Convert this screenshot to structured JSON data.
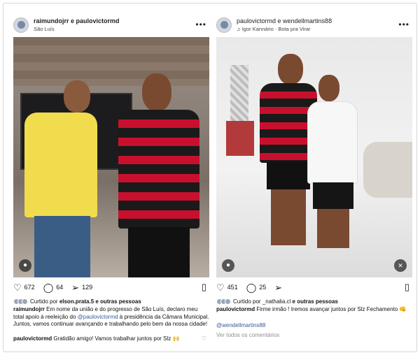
{
  "left_post": {
    "header": {
      "users": "raimundojrr e paulovictormd",
      "location": "São Luís"
    },
    "actions": {
      "likes": "672",
      "comments": "64",
      "shares": "129"
    },
    "liked_by": {
      "prefix": "Curtido por",
      "user": "elson.prata.5",
      "suffix": "e outras pessoas"
    },
    "caption": {
      "user": "raimundojrr",
      "text_before": "Em nome da união e do progresso de São Luís, declaro meu total apoio à reeleição do",
      "mention": "@paulovictormd",
      "text_after": "à presidência da Câmara Municipal. Juntos, vamos continuar avançando e trabalhando pelo bem da nossa cidade!"
    },
    "comment": {
      "user": "paulovictormd",
      "text": "Gratidão amigo! Vamos trabalhar juntos por Slz 🙌"
    }
  },
  "right_post": {
    "header": {
      "users": "paulovictormd e wendellmartins88",
      "audio": "Igor Kannário · Bota pra Virar"
    },
    "actions": {
      "likes": "451",
      "comments": "25"
    },
    "liked_by": {
      "prefix": "Curtido por",
      "user": "_nathalia.cl",
      "suffix": "e outras pessoas"
    },
    "caption": {
      "user": "paulovictormd",
      "text": "Firme irmão ! Iremos avançar juntos por Slz Fechamento 👊"
    },
    "mention": "@wendellmartins88",
    "view_comments": "Ver todos os comentários"
  },
  "icons": {
    "more": "more-options-icon",
    "heart": "heart-icon",
    "comment": "comment-icon",
    "share": "share-icon",
    "bookmark": "bookmark-icon",
    "user_tag": "user-tag-icon",
    "mute": "mute-icon"
  }
}
